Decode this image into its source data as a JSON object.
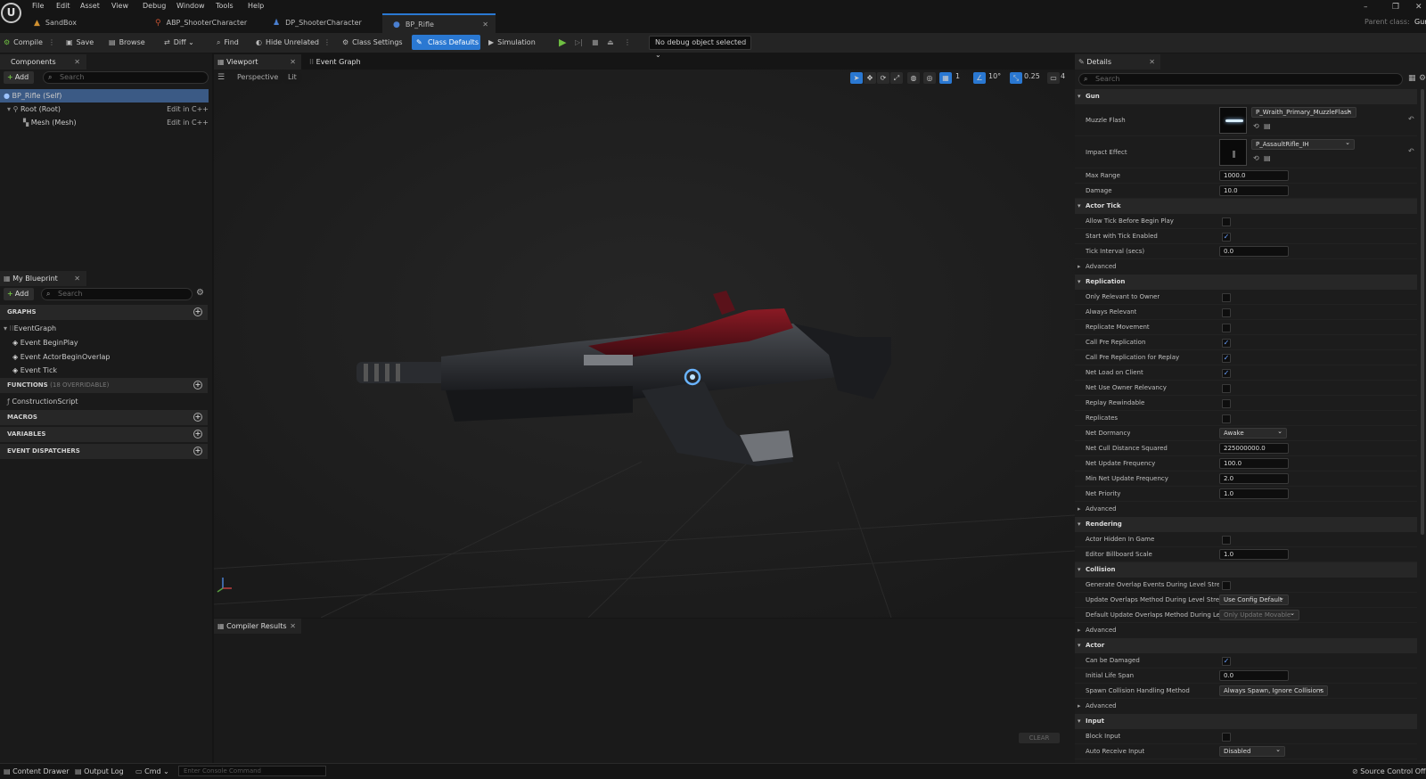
{
  "menu": [
    "File",
    "Edit",
    "Asset",
    "View",
    "Debug",
    "Window",
    "Tools",
    "Help"
  ],
  "tabs": [
    {
      "label": "SandBox",
      "icon": "level-icon"
    },
    {
      "label": "ABP_ShooterCharacter",
      "icon": "anim-blueprint-icon"
    },
    {
      "label": "DP_ShooterCharacter",
      "icon": "character-icon"
    },
    {
      "label": "BP_Rifle",
      "icon": "blueprint-icon",
      "active": true
    }
  ],
  "parent_class_label": "Parent class:",
  "parent_class_value": "Gun",
  "toolbar": {
    "compile": "Compile",
    "save": "Save",
    "browse": "Browse",
    "diff": "Diff",
    "find": "Find",
    "hide_unrelated": "Hide Unrelated",
    "class_settings": "Class Settings",
    "class_defaults": "Class Defaults",
    "simulation": "Simulation",
    "debug_object": "No debug object selected"
  },
  "components": {
    "title": "Components",
    "add": "Add",
    "search_placeholder": "Search",
    "items": [
      {
        "label": "BP_Rifle (Self)"
      },
      {
        "label": "Root (Root)",
        "action": "Edit in C++"
      },
      {
        "label": "Mesh (Mesh)",
        "action": "Edit in C++"
      }
    ]
  },
  "my_blueprint": {
    "title": "My Blueprint",
    "add": "Add",
    "search_placeholder": "Search",
    "graphs_label": "GRAPHS",
    "event_graph": "EventGraph",
    "events": [
      "Event BeginPlay",
      "Event ActorBeginOverlap",
      "Event Tick"
    ],
    "functions_label": "FUNCTIONS",
    "functions_note": "(18 OVERRIDABLE)",
    "construction_script": "ConstructionScript",
    "macros_label": "MACROS",
    "variables_label": "VARIABLES",
    "dispatchers_label": "EVENT DISPATCHERS"
  },
  "viewport": {
    "tab": "Viewport",
    "event_graph_tab": "Event Graph",
    "perspective": "Perspective",
    "lit": "Lit",
    "grid_snap": "1",
    "rotation_snap": "10°",
    "scale_snap": "0.25",
    "camera_speed": "4"
  },
  "compiler": {
    "title": "Compiler Results",
    "clear": "CLEAR"
  },
  "details": {
    "title": "Details",
    "search_placeholder": "Search",
    "advanced": "Advanced",
    "gun": {
      "section": "Gun",
      "muzzle_flash_label": "Muzzle Flash",
      "muzzle_flash_value": "P_Wraith_Primary_MuzzleFlash",
      "impact_effect_label": "Impact Effect",
      "impact_effect_value": "P_AssaultRifle_IH",
      "max_range_label": "Max Range",
      "max_range_value": "1000.0",
      "damage_label": "Damage",
      "damage_value": "10.0"
    },
    "actor_tick": {
      "section": "Actor Tick",
      "allow_tick_label": "Allow Tick Before Begin Play",
      "allow_tick": false,
      "start_tick_label": "Start with Tick Enabled",
      "start_tick": true,
      "tick_interval_label": "Tick Interval (secs)",
      "tick_interval_value": "0.0"
    },
    "replication": {
      "section": "Replication",
      "rows": [
        {
          "label": "Only Relevant to Owner",
          "checked": false
        },
        {
          "label": "Always Relevant",
          "checked": false
        },
        {
          "label": "Replicate Movement",
          "checked": false
        },
        {
          "label": "Call Pre Replication",
          "checked": true
        },
        {
          "label": "Call Pre Replication for Replay",
          "checked": true
        },
        {
          "label": "Net Load on Client",
          "checked": true
        },
        {
          "label": "Net Use Owner Relevancy",
          "checked": false
        },
        {
          "label": "Replay Rewindable",
          "checked": false
        },
        {
          "label": "Replicates",
          "checked": false
        }
      ],
      "net_dormancy_label": "Net Dormancy",
      "net_dormancy_value": "Awake",
      "net_cull_label": "Net Cull Distance Squared",
      "net_cull_value": "225000000.0",
      "net_update_label": "Net Update Frequency",
      "net_update_value": "100.0",
      "min_net_update_label": "Min Net Update Frequency",
      "min_net_update_value": "2.0",
      "net_priority_label": "Net Priority",
      "net_priority_value": "1.0"
    },
    "rendering": {
      "section": "Rendering",
      "hidden_label": "Actor Hidden In Game",
      "hidden": false,
      "billboard_label": "Editor Billboard Scale",
      "billboard_value": "1.0"
    },
    "collision": {
      "section": "Collision",
      "gen_overlap_label": "Generate Overlap Events During Level Stre...",
      "gen_overlap": false,
      "update_overlap_label": "Update Overlaps Method During Level Stre...",
      "update_overlap_value": "Use Config Default",
      "default_update_label": "Default Update Overlaps Method During Le...",
      "default_update_value": "Only Update Movable"
    },
    "actor": {
      "section": "Actor",
      "damaged_label": "Can be Damaged",
      "damaged": true,
      "lifespan_label": "Initial Life Span",
      "lifespan_value": "0.0",
      "spawn_label": "Spawn Collision Handling Method",
      "spawn_value": "Always Spawn, Ignore Collisions"
    },
    "input": {
      "section": "Input",
      "block_label": "Block Input",
      "block": false,
      "auto_label": "Auto Receive Input",
      "auto_value": "Disabled"
    }
  },
  "statusbar": {
    "content_drawer": "Content Drawer",
    "output_log": "Output Log",
    "cmd": "Cmd",
    "console_placeholder": "Enter Console Command",
    "source_control": "Source Control Off"
  }
}
